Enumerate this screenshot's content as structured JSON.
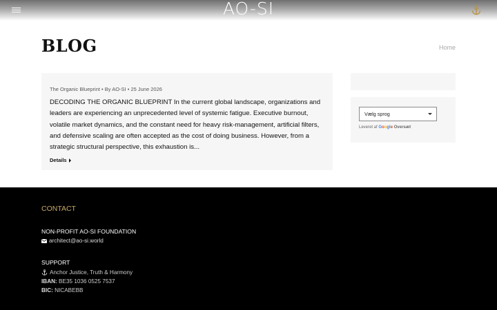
{
  "header": {
    "logo": "AO-SI",
    "menu_icon": "hamburger-menu-icon",
    "anchor_icon": "anchor-icon",
    "gradient_top": "#6f6f6f"
  },
  "page": {
    "title": "BLOG",
    "breadcrumb": "Home"
  },
  "post": {
    "category": "The Organic Blueprint",
    "sep1": "•",
    "author": "By AO-SI",
    "sep2": "•",
    "date": "25 June 2026",
    "excerpt": "DECODING THE ORGANIC BLUEPRINT In the current global landscape, organizations and leaders are experiencing an unprecedented level of systemic fatigue. Executive burnout, volatile market dynamics, and the constant need for heavy risk-management, artificial filters, and defensive scaling are often accepted as the cost of doing business. However, from a strategic structural perspective, this exhaustion is...",
    "details_label": "Details"
  },
  "sidebar": {
    "language_select": "Vælg sprog",
    "powered_by": "Leveret af",
    "google": "Google",
    "translate": "Oversæt"
  },
  "footer": {
    "contact_heading": "CONTACT",
    "foundation": "NON-PROFIT AO-SI FOUNDATION",
    "email": "architect@ao-si.world",
    "support_heading": "SUPPORT",
    "anchor_text": "Anchor Justice, Truth & Harmony",
    "iban_label": "IBAN:",
    "iban_value": "BE35 1036 0525 7537",
    "bic_label": "BIC:",
    "bic_value": "NICABEBB",
    "accent_color": "#c9a96a",
    "background": "#000000"
  }
}
